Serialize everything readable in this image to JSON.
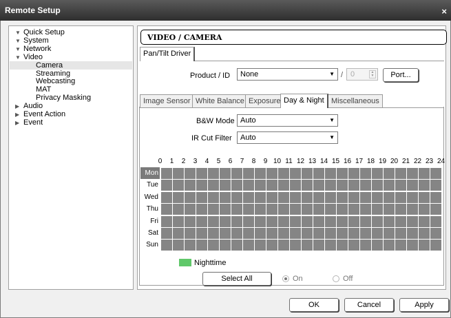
{
  "window": {
    "title": "Remote Setup",
    "close_glyph": "×"
  },
  "tree": [
    {
      "label": "Quick Setup",
      "arrow": "▼",
      "expanded": true
    },
    {
      "label": "System",
      "arrow": "▼",
      "expanded": true
    },
    {
      "label": "Network",
      "arrow": "▼",
      "expanded": true
    },
    {
      "label": "Video",
      "arrow": "▼",
      "expanded": true
    },
    {
      "label": "Camera",
      "selected": true
    },
    {
      "label": "Streaming"
    },
    {
      "label": "Webcasting"
    },
    {
      "label": "MAT"
    },
    {
      "label": "Privacy Masking"
    },
    {
      "label": "Audio",
      "arrow": "▶",
      "expanded": false
    },
    {
      "label": "Event Action",
      "arrow": "▶",
      "expanded": false
    },
    {
      "label": "Event",
      "arrow": "▶",
      "expanded": false
    }
  ],
  "header": {
    "title": "VIDEO / CAMERA"
  },
  "top_tabs": [
    {
      "label": "Pan/Tilt Driver",
      "active": true
    }
  ],
  "pantilt": {
    "product_label": "Product / ID",
    "product_value": "None",
    "separator": "/",
    "id_value": "0",
    "port_button": "Port..."
  },
  "sub_tabs": [
    {
      "label": "Image Sensor",
      "active": false
    },
    {
      "label": "White Balance",
      "active": false
    },
    {
      "label": "Exposure",
      "active": false
    },
    {
      "label": "Day & Night",
      "active": true
    },
    {
      "label": "Miscellaneous",
      "active": false
    }
  ],
  "day_night": {
    "bw_mode_label": "B&W Mode",
    "bw_mode_value": "Auto",
    "ir_cut_label": "IR Cut Filter",
    "ir_cut_value": "Auto"
  },
  "schedule": {
    "hours": [
      "0",
      "1",
      "2",
      "3",
      "4",
      "5",
      "6",
      "7",
      "8",
      "9",
      "10",
      "11",
      "12",
      "13",
      "14",
      "15",
      "16",
      "17",
      "18",
      "19",
      "20",
      "21",
      "22",
      "23",
      "24"
    ],
    "days": [
      "Mon",
      "Tue",
      "Wed",
      "Thu",
      "Fri",
      "Sat",
      "Sun"
    ],
    "selected_day": "Mon",
    "legend_label": "Nighttime",
    "legend_color": "#60c86a",
    "cell_color": "#858585",
    "select_all_button": "Select All",
    "radio_on_label": "On",
    "radio_off_label": "Off",
    "radio_on_checked": true,
    "radio_off_checked": false
  },
  "footer": {
    "ok": "OK",
    "cancel": "Cancel",
    "apply": "Apply"
  }
}
